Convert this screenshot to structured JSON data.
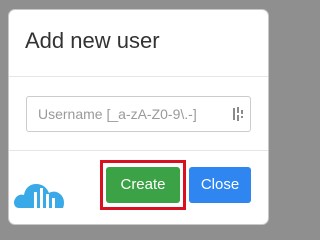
{
  "dialog": {
    "title": "Add new user",
    "username_input": {
      "value": "",
      "placeholder": "Username [_a-zA-Z0-9\\.-]"
    },
    "buttons": {
      "create_label": "Create",
      "close_label": "Close"
    },
    "icons": {
      "input_trailing": "password-manager-icon",
      "logo": "cloud-logo-icon"
    },
    "colors": {
      "create": "#3ba245",
      "close": "#2f86f0",
      "highlight": "#d9101f",
      "logo": "#3aa9e8"
    }
  }
}
